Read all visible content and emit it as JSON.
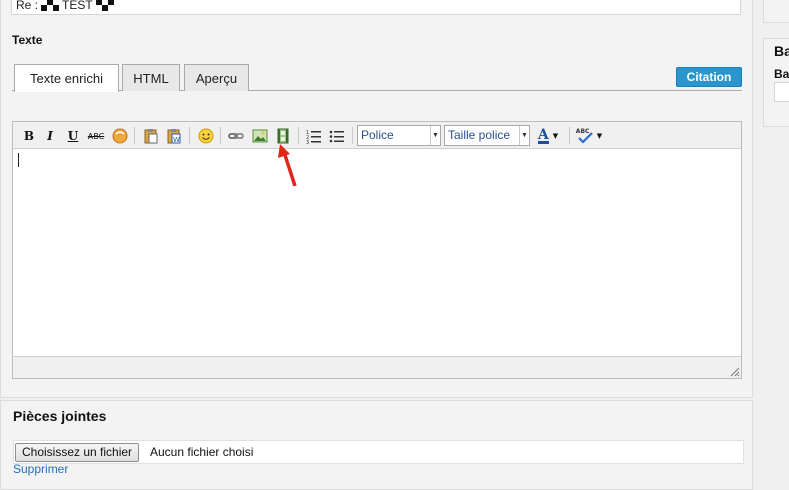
{
  "subject": {
    "prefix": "Re :",
    "word": "TEST"
  },
  "texte_label": "Texte",
  "tabs": [
    "Texte enrichi",
    "HTML",
    "Aperçu"
  ],
  "citation_label": "Citation",
  "toolbar": {
    "bold": "B",
    "italic": "I",
    "underline": "U",
    "strike": "ABC",
    "font_placeholder": "Police",
    "size_placeholder": "Taille police",
    "font_color_letter": "A",
    "spell_letters": "ABC",
    "icons": [
      "bold-icon",
      "italic-icon",
      "underline-icon",
      "strikethrough-icon",
      "mood-icon",
      "paste-icon",
      "paste-word-icon",
      "smiley-icon",
      "link-icon",
      "image-icon",
      "video-icon",
      "numbered-list-icon",
      "bulleted-list-icon",
      "font-color-icon",
      "spellcheck-icon"
    ]
  },
  "attachments": {
    "title": "Pièces jointes",
    "choose_button": "Choisissez un fichier",
    "status": "Aucun fichier choisi",
    "delete_link": "Supprimer"
  },
  "right_panel": {
    "title": "Ba",
    "label": "Ba"
  },
  "colors": {
    "accent": "#2996cf",
    "link": "#2b6cb0",
    "arrow": "#e0261b"
  }
}
